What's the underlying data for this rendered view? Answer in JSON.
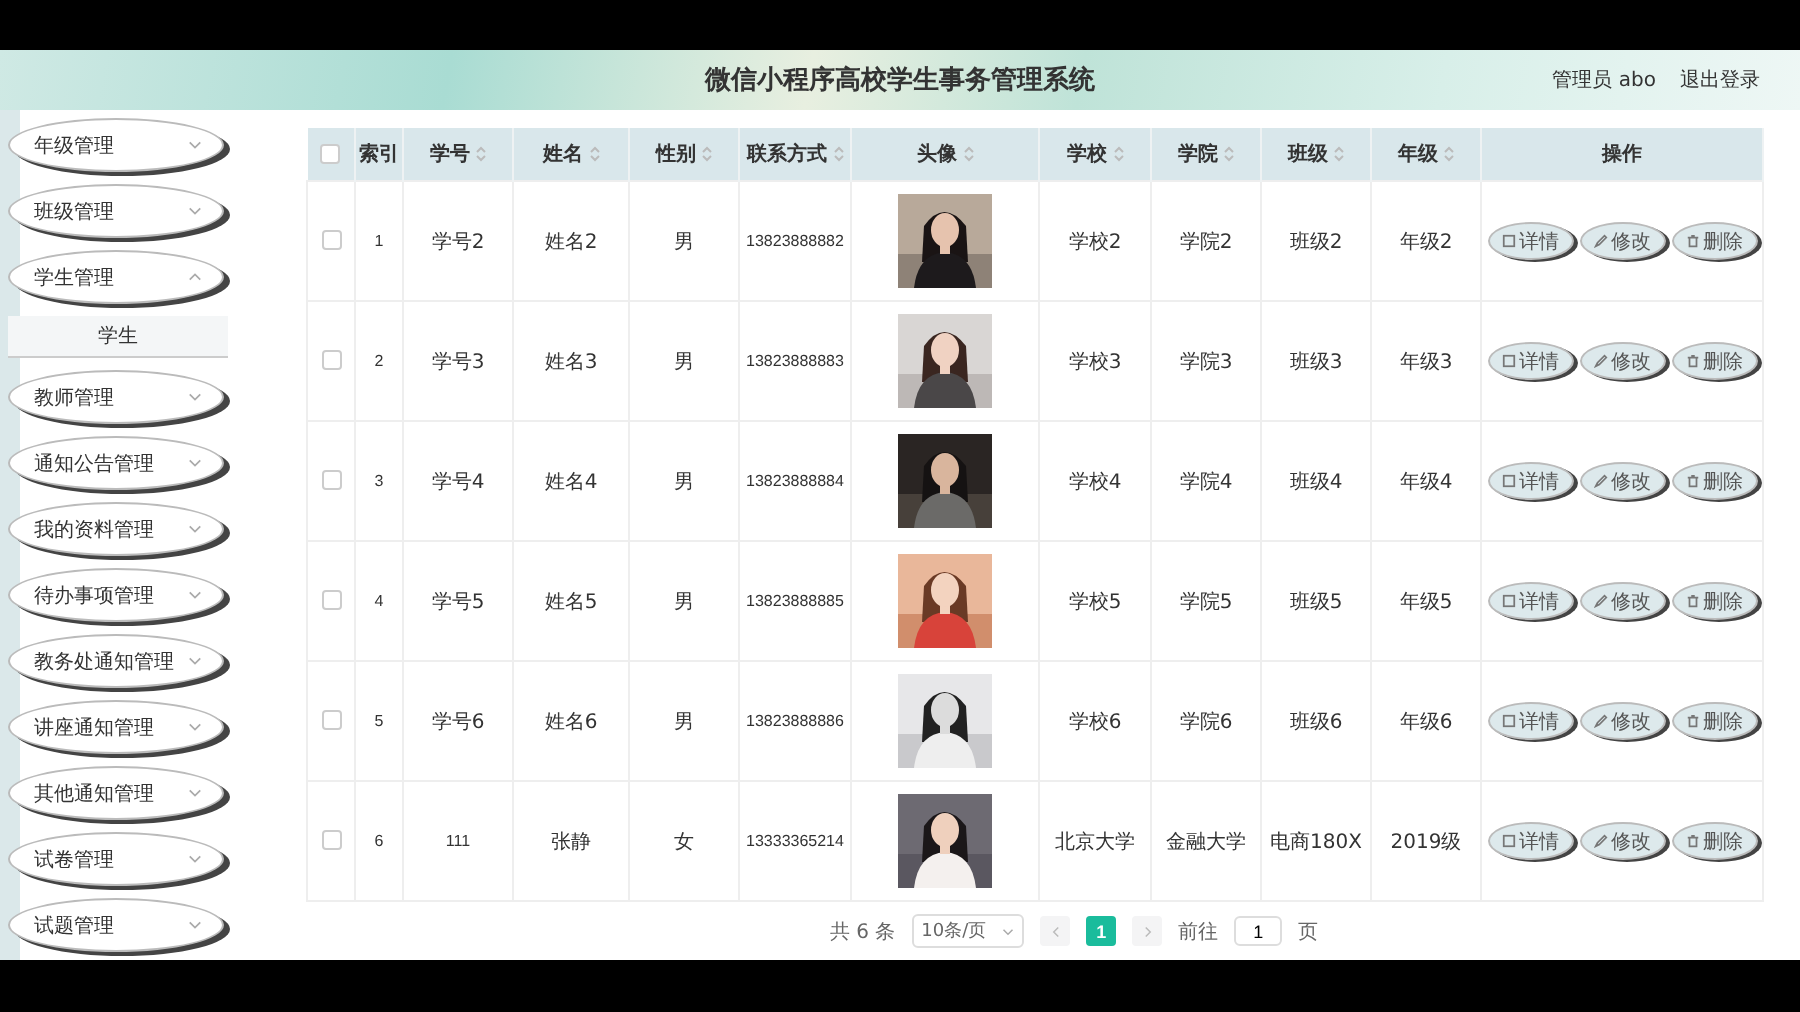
{
  "header": {
    "title": "微信小程序高校学生事务管理系统",
    "user": "管理员 abo",
    "logout": "退出登录"
  },
  "sidebar": {
    "items": [
      {
        "label": "年级管理",
        "expanded": false
      },
      {
        "label": "班级管理",
        "expanded": false
      },
      {
        "label": "学生管理",
        "expanded": true,
        "children": [
          {
            "label": "学生"
          }
        ]
      },
      {
        "label": "教师管理",
        "expanded": false
      },
      {
        "label": "通知公告管理",
        "expanded": false
      },
      {
        "label": "我的资料管理",
        "expanded": false
      },
      {
        "label": "待办事项管理",
        "expanded": false
      },
      {
        "label": "教务处通知管理",
        "expanded": false
      },
      {
        "label": "讲座通知管理",
        "expanded": false
      },
      {
        "label": "其他通知管理",
        "expanded": false
      },
      {
        "label": "试卷管理",
        "expanded": false
      },
      {
        "label": "试题管理",
        "expanded": false
      }
    ]
  },
  "table": {
    "select_all": {
      "checked": false
    },
    "columns": [
      {
        "label": "索引",
        "sortable": false
      },
      {
        "label": "学号",
        "sortable": true
      },
      {
        "label": "姓名",
        "sortable": true
      },
      {
        "label": "性别",
        "sortable": true
      },
      {
        "label": "联系方式",
        "sortable": true
      },
      {
        "label": "头像",
        "sortable": true
      },
      {
        "label": "学校",
        "sortable": true
      },
      {
        "label": "学院",
        "sortable": true
      },
      {
        "label": "班级",
        "sortable": true
      },
      {
        "label": "年级",
        "sortable": true
      },
      {
        "label": "操作",
        "sortable": false
      }
    ],
    "rows": [
      {
        "checked": false,
        "cells": [
          "1",
          "学号2",
          "姓名2",
          "男",
          "13823888882"
        ],
        "cells_after": [
          "学校2",
          "学院2",
          "班级2",
          "年级2"
        ],
        "actions": [
          {
            "label": "详情",
            "kind": "detail"
          },
          {
            "label": "修改",
            "kind": "edit"
          },
          {
            "label": "删除",
            "kind": "delete"
          }
        ]
      },
      {
        "checked": false,
        "cells": [
          "2",
          "学号3",
          "姓名3",
          "男",
          "13823888883"
        ],
        "cells_after": [
          "学校3",
          "学院3",
          "班级3",
          "年级3"
        ],
        "actions": [
          {
            "label": "详情",
            "kind": "detail"
          },
          {
            "label": "修改",
            "kind": "edit"
          },
          {
            "label": "删除",
            "kind": "delete"
          }
        ]
      },
      {
        "checked": false,
        "cells": [
          "3",
          "学号4",
          "姓名4",
          "男",
          "13823888884"
        ],
        "cells_after": [
          "学校4",
          "学院4",
          "班级4",
          "年级4"
        ],
        "actions": [
          {
            "label": "详情",
            "kind": "detail"
          },
          {
            "label": "修改",
            "kind": "edit"
          },
          {
            "label": "删除",
            "kind": "delete"
          }
        ]
      },
      {
        "checked": false,
        "cells": [
          "4",
          "学号5",
          "姓名5",
          "男",
          "13823888885"
        ],
        "cells_after": [
          "学校5",
          "学院5",
          "班级5",
          "年级5"
        ],
        "actions": [
          {
            "label": "详情",
            "kind": "detail"
          },
          {
            "label": "修改",
            "kind": "edit"
          },
          {
            "label": "删除",
            "kind": "delete"
          }
        ]
      },
      {
        "checked": false,
        "cells": [
          "5",
          "学号6",
          "姓名6",
          "男",
          "13823888886"
        ],
        "cells_after": [
          "学校6",
          "学院6",
          "班级6",
          "年级6"
        ],
        "actions": [
          {
            "label": "详情",
            "kind": "detail"
          },
          {
            "label": "修改",
            "kind": "edit"
          },
          {
            "label": "删除",
            "kind": "delete"
          }
        ]
      },
      {
        "checked": false,
        "cells": [
          "6",
          "111",
          "张静",
          "女",
          "13333365214"
        ],
        "cells_after": [
          "北京大学",
          "金融大学",
          "电商180X",
          "2019级"
        ],
        "actions": [
          {
            "label": "详情",
            "kind": "detail"
          },
          {
            "label": "修改",
            "kind": "edit"
          },
          {
            "label": "删除",
            "kind": "delete"
          }
        ]
      }
    ]
  },
  "pagination": {
    "total": "共 6 条",
    "page_size": "10条/页",
    "pages": [
      {
        "label": "1",
        "selected": true
      }
    ],
    "goto_label": "前往",
    "goto_value": "1",
    "goto_suffix": "页"
  }
}
